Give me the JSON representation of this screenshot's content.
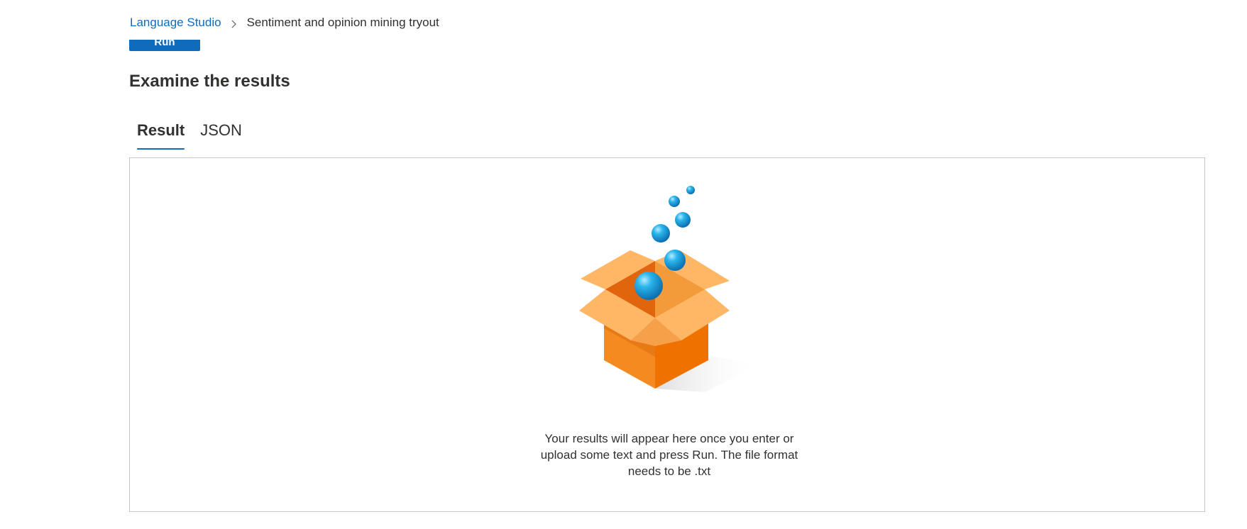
{
  "toolbar": {
    "run_label": "Run"
  },
  "breadcrumb": {
    "root_label": "Language Studio",
    "current_label": "Sentiment and opinion mining tryout"
  },
  "results": {
    "title": "Examine the results",
    "tabs": [
      {
        "label": "Result",
        "active": true
      },
      {
        "label": "JSON",
        "active": false
      }
    ],
    "empty_message": "Your results will appear here once you enter or upload some text and press Run. The file format needs to be .txt",
    "illustration_icon": "open-box-with-bubbles-icon"
  },
  "colors": {
    "accent": "#0f6cbd",
    "box_orange": "#f28a1e",
    "bubble_blue": "#1ba1e2"
  }
}
